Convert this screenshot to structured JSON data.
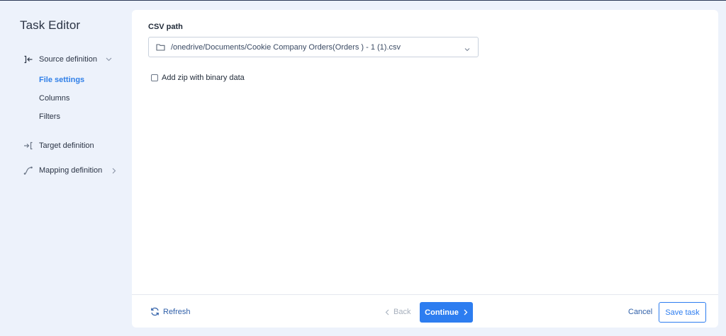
{
  "app": {
    "title": "Task Editor"
  },
  "sidebar": {
    "items": [
      {
        "label": "Source definition",
        "icon": "source-arrow-icon",
        "expanded": true,
        "children": [
          {
            "label": "File settings",
            "active": true
          },
          {
            "label": "Columns",
            "active": false
          },
          {
            "label": "Filters",
            "active": false
          }
        ]
      },
      {
        "label": "Target definition",
        "icon": "target-arrow-icon"
      },
      {
        "label": "Mapping definition",
        "icon": "mapping-curve-icon"
      }
    ]
  },
  "main": {
    "csv_path_label": "CSV path",
    "csv_path_value": "/onedrive/Documents/Cookie Company Orders(Orders ) - 1 (1).csv",
    "zip_checkbox_label": "Add zip with binary data",
    "zip_checkbox_checked": false
  },
  "footer": {
    "refresh_label": "Refresh",
    "back_label": "Back",
    "continue_label": "Continue",
    "cancel_label": "Cancel",
    "save_label": "Save task"
  },
  "colors": {
    "accent": "#2d7df0",
    "active_nav": "#2f7fe8",
    "sidebar_bg": "#edf2fb",
    "panel_bg": "#ffffff"
  }
}
